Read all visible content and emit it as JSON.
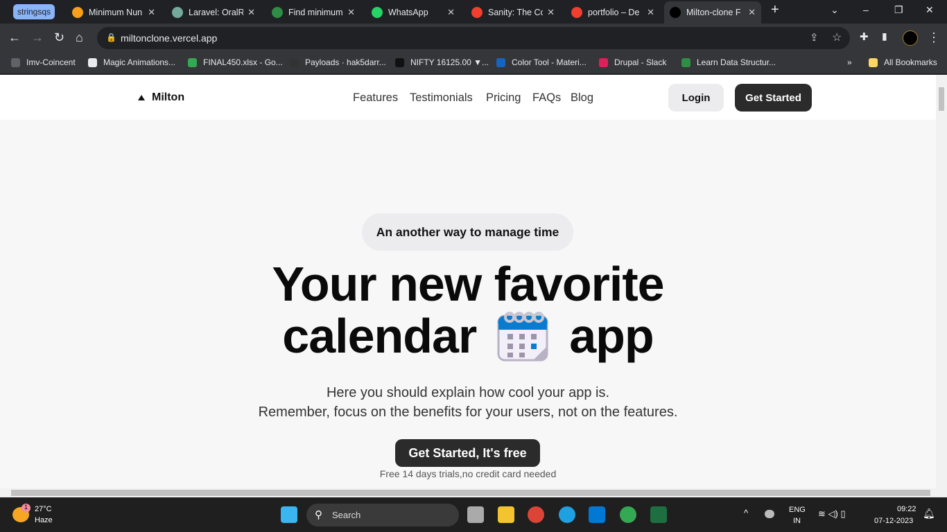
{
  "browser": {
    "tab_group": "stringsqs",
    "tabs": [
      {
        "title": "Minimum Nun",
        "icon": "leetcode-icon",
        "color": "#f89f1b"
      },
      {
        "title": "Laravel: OralRe",
        "icon": "chatgpt-icon",
        "color": "#74aa9c"
      },
      {
        "title": "Find minimum",
        "icon": "gfg-icon",
        "color": "#2f8d46"
      },
      {
        "title": "WhatsApp",
        "icon": "whatsapp-icon",
        "color": "#25d366"
      },
      {
        "title": "Sanity: The Co",
        "icon": "sanity-icon",
        "color": "#f03e2f"
      },
      {
        "title": "portfolio – De",
        "icon": "sanity-icon",
        "color": "#f03e2f"
      },
      {
        "title": "Milton-clone F",
        "icon": "milton-icon",
        "color": "#000000",
        "active": true
      }
    ],
    "url": "miltonclone.vercel.app",
    "bookmarks": [
      "Imv-Coincent",
      "Magic Animations...",
      "FINAL450.xlsx - Go...",
      "Payloads · hak5darr...",
      "NIFTY 16125.00 ▼...",
      "Color Tool - Materi...",
      "Drupal  - Slack",
      "Learn Data Structur..."
    ],
    "bookmark_colors": [
      "#5f6368",
      "#e8eaed",
      "#34a853",
      "#333333",
      "#111111",
      "#1565c0",
      "#e01e5a",
      "#2f8d46"
    ],
    "all_bookmarks": "All Bookmarks",
    "more": "»"
  },
  "site": {
    "logo": "Milton",
    "nav": [
      "Features",
      "Testimonials",
      "Pricing",
      "FAQs",
      "Blog"
    ],
    "login": "Login",
    "get_started": "Get Started",
    "badge": "An another way to manage time",
    "headline_1": "Your new favorite",
    "headline_2a": "calendar",
    "headline_2b": "app",
    "sub_1": "Here you should explain how cool your app is.",
    "sub_2": "Remember, focus on the benefits for your users, not on the features.",
    "cta": "Get Started, It's free",
    "cta_note": "Free 14 days trials,no credit card needed"
  },
  "taskbar": {
    "weather_temp": "27°C",
    "weather_desc": "Haze",
    "weather_badge": "1",
    "search": "Search",
    "lang": "ENG",
    "region": "IN",
    "time": "09:22",
    "date": "07-12-2023"
  }
}
